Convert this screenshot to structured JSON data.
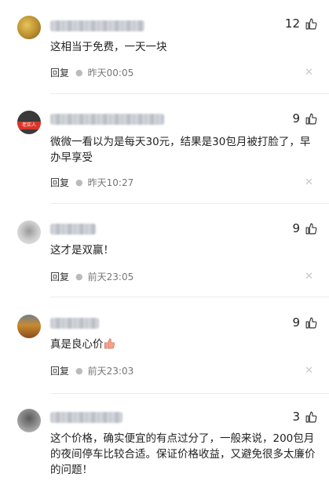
{
  "reply_label": "回复",
  "comments": [
    {
      "likes": "12",
      "text": "这相当于免费，一天一块",
      "time": "昨天00:05"
    },
    {
      "likes": "9",
      "text": "微微一看以为是每天30元，结果是30包月被打脸了，早办早享受",
      "time": "昨天10:27",
      "avatar_label": "老实人"
    },
    {
      "likes": "9",
      "text": "这才是双赢！",
      "time": "前天23:05"
    },
    {
      "likes": "9",
      "text": "真是良心价",
      "time": "前天23:03"
    },
    {
      "likes": "3",
      "text": "这个价格，确实便宜的有点过分了，一般来说，200包月的夜间停车比较合适。保证价格收益，又避免很多太廉价的问题！"
    }
  ],
  "icons": {
    "like": "thumbs-up-icon",
    "dismiss": "close-icon"
  }
}
